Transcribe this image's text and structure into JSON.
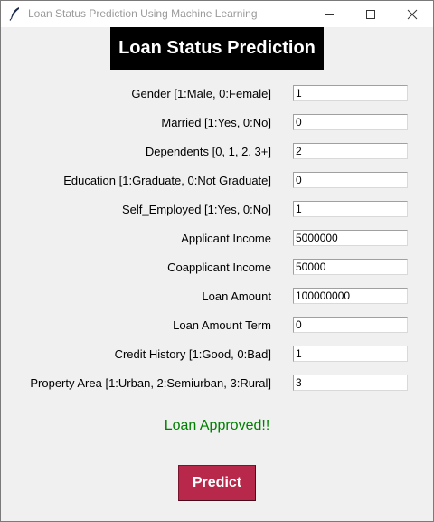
{
  "window": {
    "title": "Loan Status Prediction Using Machine Learning"
  },
  "heading": "Loan Status Prediction",
  "fields": [
    {
      "label": "Gender [1:Male, 0:Female]",
      "value": "1"
    },
    {
      "label": "Married [1:Yes, 0:No]",
      "value": "0"
    },
    {
      "label": "Dependents [0, 1, 2, 3+]",
      "value": "2"
    },
    {
      "label": "Education [1:Graduate, 0:Not Graduate]",
      "value": "0"
    },
    {
      "label": "Self_Employed [1:Yes, 0:No]",
      "value": "1"
    },
    {
      "label": "Applicant Income",
      "value": "5000000"
    },
    {
      "label": "Coapplicant Income",
      "value": "50000"
    },
    {
      "label": "Loan Amount",
      "value": "100000000"
    },
    {
      "label": "Loan Amount Term",
      "value": "0"
    },
    {
      "label": "Credit History [1:Good, 0:Bad]",
      "value": "1"
    },
    {
      "label": "Property Area [1:Urban, 2:Semiurban, 3:Rural]",
      "value": "3"
    }
  ],
  "result_text": "Loan Approved!!",
  "predict_label": "Predict",
  "colors": {
    "heading_bg": "#000000",
    "heading_fg": "#ffffff",
    "result": "#008000",
    "button_bg": "#b8284a",
    "window_bg": "#f0f0f0"
  }
}
